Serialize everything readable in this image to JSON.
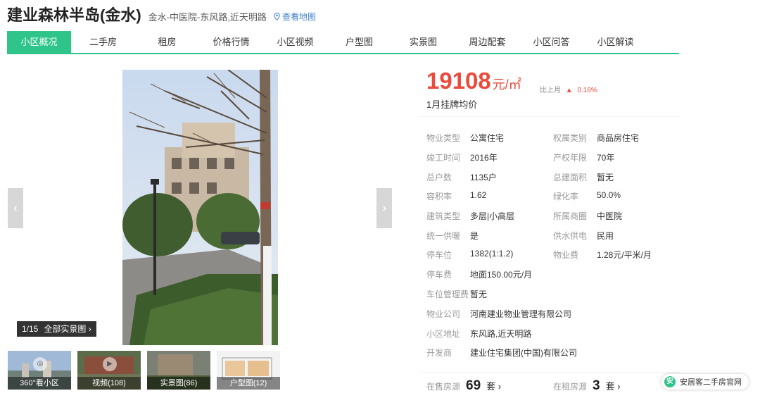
{
  "header": {
    "title": "建业森林半岛(金水)",
    "location": "金水-中医院-东风路,近天明路",
    "map_link": "查看地图"
  },
  "tabs": [
    {
      "label": "小区概况",
      "active": true
    },
    {
      "label": "二手房",
      "active": false
    },
    {
      "label": "租房",
      "active": false
    },
    {
      "label": "价格行情",
      "active": false
    },
    {
      "label": "小区视频",
      "active": false
    },
    {
      "label": "户型图",
      "active": false
    },
    {
      "label": "实景图",
      "active": false
    },
    {
      "label": "周边配套",
      "active": false
    },
    {
      "label": "小区问答",
      "active": false
    },
    {
      "label": "小区解读",
      "active": false
    }
  ],
  "gallery": {
    "counter": "1/15",
    "all_photos": "全部实景图 ›",
    "prev_icon": "chevron-left-icon",
    "next_icon": "chevron-right-icon",
    "thumbs": [
      {
        "label": "360°看小区",
        "icon": "panorama-icon"
      },
      {
        "label": "视频(108)",
        "icon": "play-icon"
      },
      {
        "label": "实景图(86)",
        "icon": "photo-icon",
        "selected": true
      },
      {
        "label": "户型图(12)",
        "icon": "floorplan-icon"
      }
    ]
  },
  "price": {
    "value": "19108",
    "unit": "元/㎡",
    "compare_label": "比上月",
    "compare_arrow": "▲",
    "compare_value": "0.16%",
    "label": "1月挂牌均价"
  },
  "info": {
    "left": [
      {
        "label": "物业类型",
        "value": "公寓住宅"
      },
      {
        "label": "竣工时间",
        "value": "2016年"
      },
      {
        "label": "总户数",
        "value": "1135户"
      },
      {
        "label": "容积率",
        "value": "1.62"
      },
      {
        "label": "建筑类型",
        "value": "多层|小高层"
      },
      {
        "label": "统一供暖",
        "value": "是"
      },
      {
        "label": "停车位",
        "value": "1382(1:1.2)"
      },
      {
        "label": "停车费",
        "value": "地面150.00元/月"
      },
      {
        "label": "车位管理费",
        "value": "暂无"
      },
      {
        "label": "物业公司",
        "value": "河南建业物业管理有限公司"
      },
      {
        "label": "小区地址",
        "value": "东风路,近天明路"
      },
      {
        "label": "开发商",
        "value": "建业住宅集团(中国)有限公司"
      }
    ],
    "right": [
      {
        "label": "权属类别",
        "value": "商品房住宅"
      },
      {
        "label": "产权年限",
        "value": "70年"
      },
      {
        "label": "总建面积",
        "value": "暂无"
      },
      {
        "label": "绿化率",
        "value": "50.0%"
      },
      {
        "label": "所属商圈",
        "value": "中医院"
      },
      {
        "label": "供水供电",
        "value": "民用"
      },
      {
        "label": "物业费",
        "value": "1.28元/平米/月"
      }
    ]
  },
  "listings": {
    "sale_label": "在售房源",
    "sale_count": "69",
    "sale_unit": "套 ›",
    "rent_label": "在租房源",
    "rent_count": "3",
    "rent_unit": "套 ›"
  },
  "watermark": {
    "text": "安居客二手房官网",
    "logo": "安"
  },
  "colors": {
    "accent": "#2ec48a",
    "price": "#e94b3c"
  }
}
